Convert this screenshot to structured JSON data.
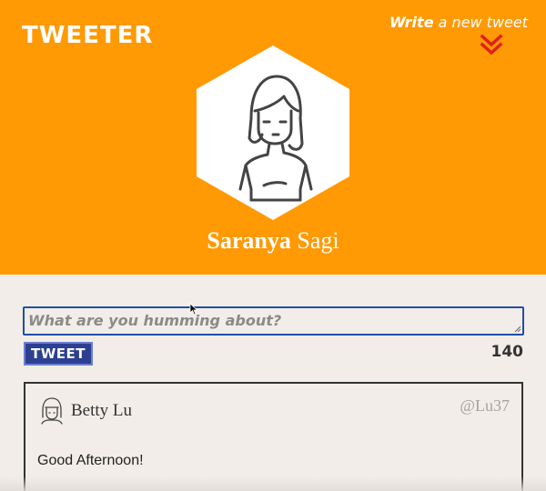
{
  "header": {
    "brand": "TWEETER",
    "compose_link": {
      "bold": "Write",
      "rest": " a new tweet"
    },
    "profile": {
      "first_name": "Saranya",
      "last_name": "Sagi"
    }
  },
  "composer": {
    "placeholder": "What are you humming about?",
    "value": "",
    "submit_label": "TWEET",
    "char_counter": "140"
  },
  "tweets": [
    {
      "name": "Betty Lu",
      "handle": "@Lu37",
      "text": "Good Afternoon!"
    }
  ],
  "colors": {
    "banner": "#ff9a04",
    "accent": "#2c3f91",
    "chevron": "#e0201c",
    "background": "#f2ede8"
  },
  "icons": {
    "chevron": "chevron-double-down-icon",
    "avatar": "avatar-icon"
  }
}
